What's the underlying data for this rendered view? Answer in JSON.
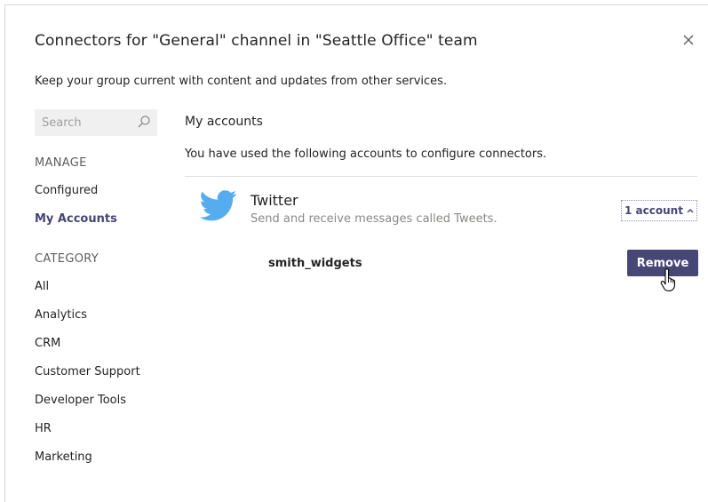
{
  "dialog": {
    "title": "Connectors for \"General\" channel in \"Seattle Office\" team",
    "subtitle": "Keep your group current with content and updates from other services."
  },
  "sidebar": {
    "search_placeholder": "Search",
    "manage_header": "MANAGE",
    "manage_items": [
      {
        "label": "Configured",
        "active": false
      },
      {
        "label": "My Accounts",
        "active": true
      }
    ],
    "category_header": "CATEGORY",
    "category_items": [
      {
        "label": "All"
      },
      {
        "label": "Analytics"
      },
      {
        "label": "CRM"
      },
      {
        "label": "Customer Support"
      },
      {
        "label": "Developer Tools"
      },
      {
        "label": "HR"
      },
      {
        "label": "Marketing"
      }
    ]
  },
  "main": {
    "heading": "My accounts",
    "description": "You have used the following accounts to configure connectors.",
    "service": {
      "icon": "twitter-bird-icon",
      "name": "Twitter",
      "description": "Send and receive messages called Tweets.",
      "account_toggle_label": "1 account",
      "accounts": [
        {
          "name": "smith_widgets",
          "action_label": "Remove"
        }
      ]
    }
  },
  "colors": {
    "accent": "#464775",
    "twitter_blue": "#55acee",
    "muted_text": "#8a8886"
  }
}
